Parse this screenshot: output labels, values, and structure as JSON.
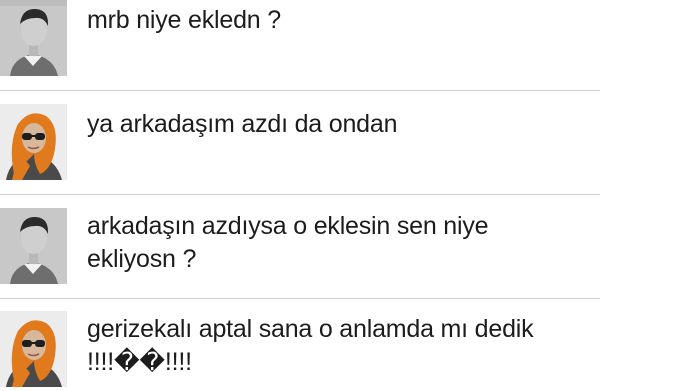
{
  "messages": [
    {
      "sender": "male",
      "text": "mrb niye ekledn ?"
    },
    {
      "sender": "female",
      "text": "ya arkadaşım azdı da ondan"
    },
    {
      "sender": "male",
      "text_line1": "arkadaşın azdıysa o eklesin sen niye",
      "text_line2": "ekliyosn ?"
    },
    {
      "sender": "female",
      "text_line1": "gerizekalı aptal sana o anlamda mı dedik",
      "text_line2": "!!!!��!!!!"
    }
  ],
  "avatars": {
    "male": "male-user-avatar",
    "female": "female-user-avatar-orange-headscarf"
  },
  "colors": {
    "divider": "#cfcfcf",
    "text": "#1c1c1c",
    "headscarf": "#e07a1c"
  }
}
